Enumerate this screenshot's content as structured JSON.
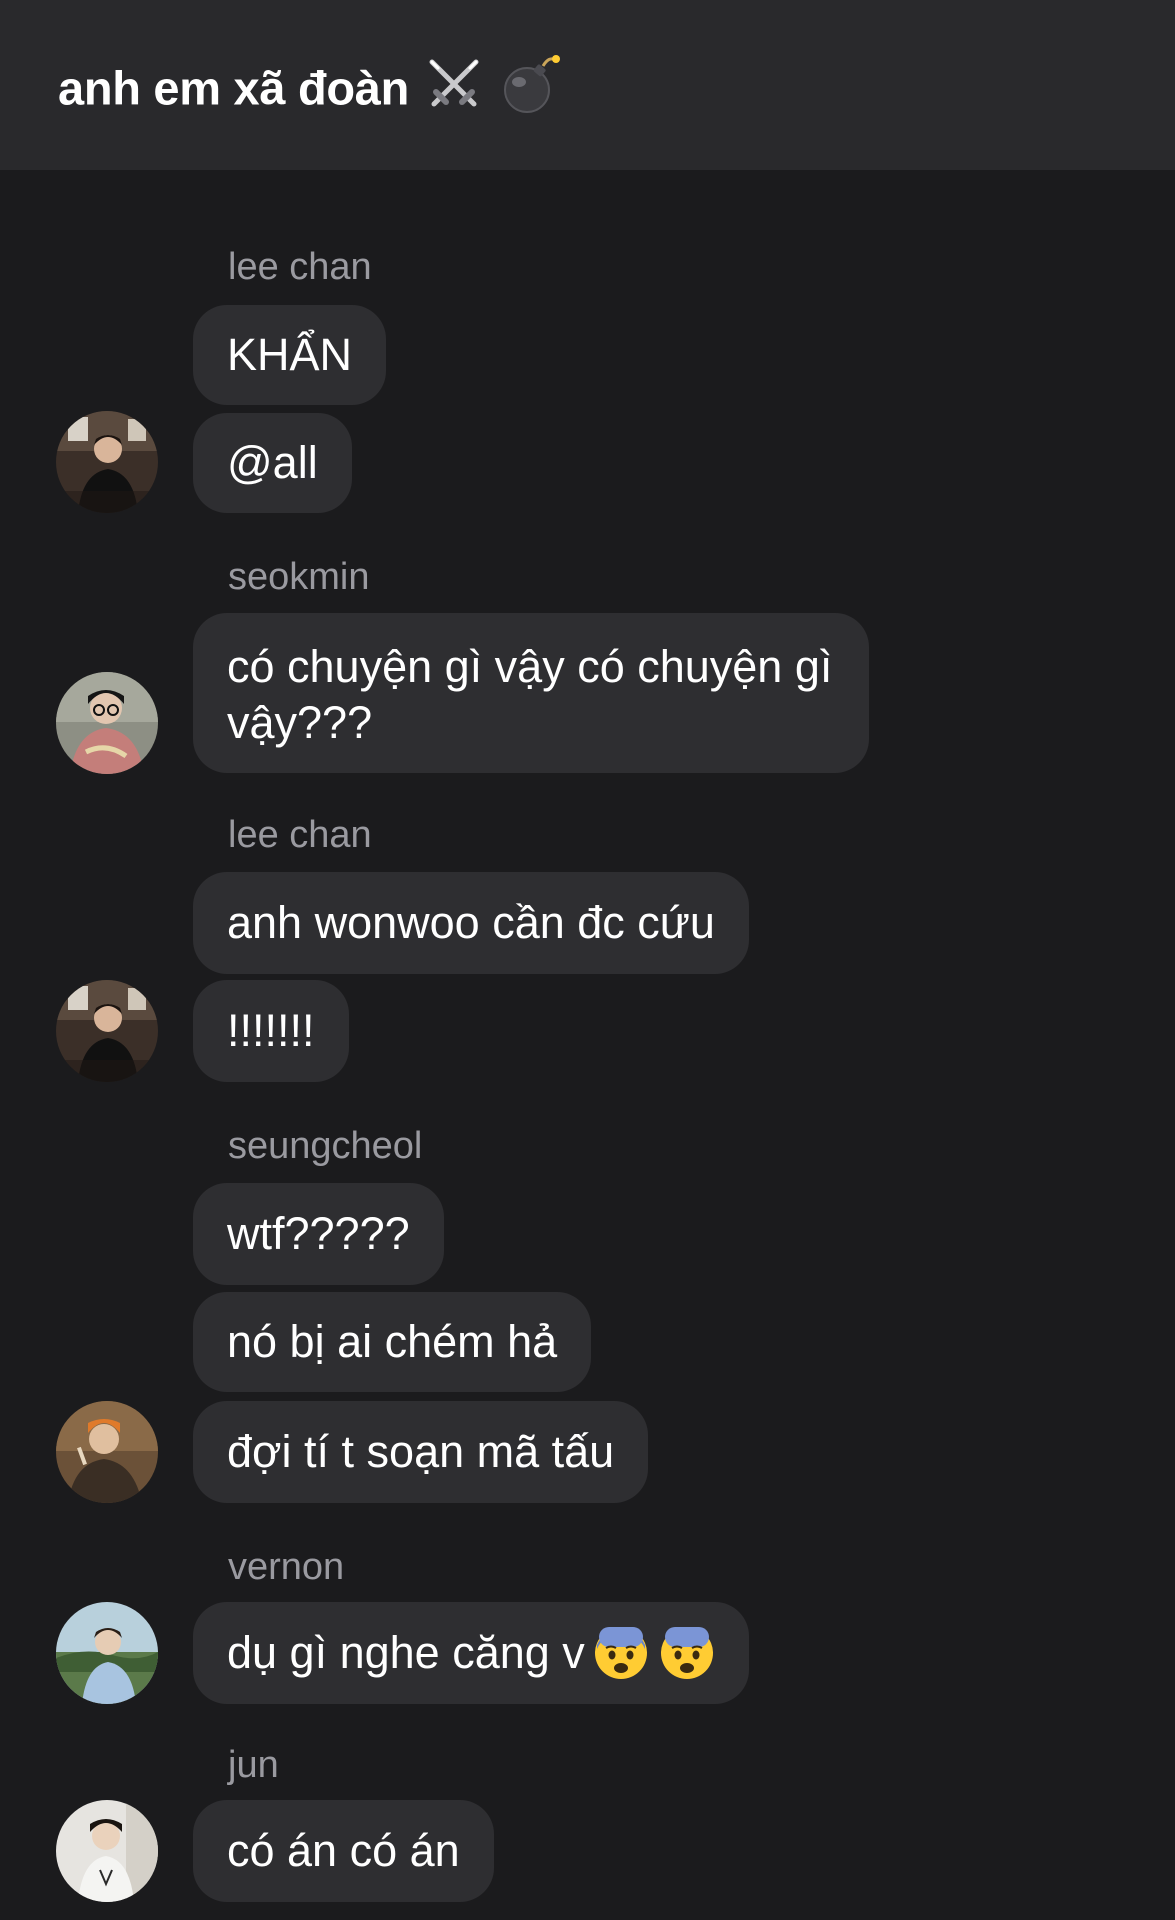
{
  "header": {
    "title": "anh em xã đoàn",
    "title_icons": [
      "crossed-swords-icon",
      "bomb-icon"
    ]
  },
  "messages": [
    {
      "sender": "lee chan",
      "bubbles": [
        "KHẨN",
        "@all"
      ]
    },
    {
      "sender": "seokmin",
      "bubbles": [
        "có chuyện gì vậy có chuyện gì vậy???"
      ]
    },
    {
      "sender": "lee chan",
      "bubbles": [
        "anh wonwoo cần đc cứu",
        "!!!!!!!"
      ]
    },
    {
      "sender": "seungcheol",
      "bubbles": [
        "wtf?????",
        "nó bị ai chém hả",
        "đợi tí t soạn mã tấu"
      ]
    },
    {
      "sender": "vernon",
      "bubbles": [
        "dụ gì nghe căng v"
      ],
      "emoji_suffix": [
        "fearful-face-icon",
        "fearful-face-icon"
      ]
    },
    {
      "sender": "jun",
      "bubbles": [
        "có án có án"
      ]
    }
  ],
  "colors": {
    "background": "#1b1b1d",
    "header": "#29292c",
    "bubble": "#2e2e31",
    "sender_name": "#9a9aa0",
    "text": "#ffffff"
  }
}
